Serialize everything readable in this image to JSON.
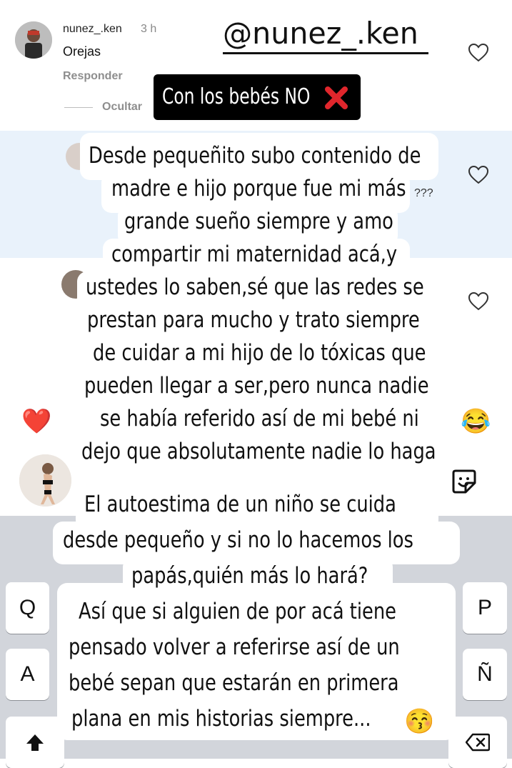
{
  "header": {
    "username": "nunez_.ken",
    "time": "3 h",
    "comment": "Orejas",
    "reply_label": "Responder",
    "hide_label": "Ocultar",
    "watermark": "@nunez_.ken"
  },
  "story": {
    "banner": "Con los bebés NO",
    "paragraph1": [
      "Desde pequeñito subo contenido de",
      "madre e hijo porque fue mi más",
      "grande sueño siempre y amo",
      "compartir mi maternidad acá,y",
      "ustedes lo saben,sé que las redes se",
      "prestan para mucho y trato siempre",
      "de cuidar a mi hijo de lo tóxicas que",
      "pueden llegar a ser,pero nunca nadie",
      "se había referido así de mi bebé ni",
      "dejo que absolutamente nadie lo haga"
    ],
    "paragraph2": [
      "El autoestima de un niño se cuida",
      "desde pequeño y si no lo hacemos los",
      "papás,quién más lo hará?",
      "Así que si alguien de por acá tiene",
      "pensado volver a referirse así de un",
      "bebé sepan que estarán en primera",
      "plana en mis historias siempre..."
    ],
    "closing_emoji": "😚"
  },
  "comments": {
    "hidden_suffix": "???"
  },
  "reactions": {
    "heart": "❤️",
    "laugh": "😂"
  },
  "keyboard": {
    "keys": {
      "q": "Q",
      "p": "P",
      "a": "A",
      "enye": "Ñ"
    }
  },
  "colors": {
    "highlight": "#e9f2fb",
    "keyboard_bg": "#d2d5db",
    "banner_bg": "#000000",
    "red_x": "#e0262c"
  }
}
